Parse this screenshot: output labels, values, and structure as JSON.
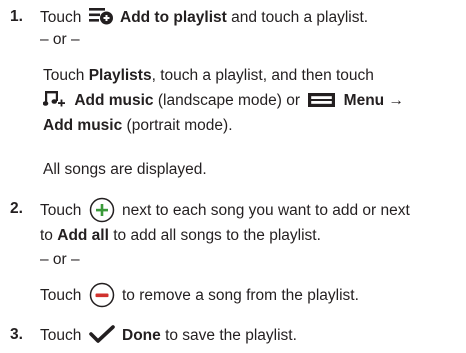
{
  "step1": {
    "num": "1.",
    "touch": "Touch",
    "add_to_playlist": "Add to playlist",
    "and_touch": "and touch a playlist.",
    "or": "– or –",
    "touch2": "Touch",
    "playlists": "Playlists",
    "rest_line": ", touch a playlist, and then touch",
    "add_music": "Add music",
    "landscape": "(landscape mode) or",
    "menu": "Menu",
    "arrow": "→",
    "add_music2": "Add music",
    "portrait": "(portrait mode).",
    "displayed": "All songs are displayed."
  },
  "step2": {
    "num": "2.",
    "touch": "Touch",
    "next_each": "next to each song you want to add or next",
    "to": "to",
    "add_all": "Add all",
    "to_add_all": "to add all songs to the playlist.",
    "or": "– or –",
    "touch2": "Touch",
    "remove": "to remove a song from the playlist."
  },
  "step3": {
    "num": "3.",
    "touch": "Touch",
    "done": "Done",
    "save": "to save the playlist."
  },
  "icons": {
    "add_to_playlist": "playlist-add-icon",
    "add_music": "music-add-icon",
    "menu": "menu-icon",
    "plus": "plus-circle-icon",
    "minus": "minus-circle-icon",
    "done": "checkmark-icon"
  },
  "colors": {
    "plus": "#3a9a3a",
    "minus": "#d0312d",
    "text": "#231f20"
  }
}
